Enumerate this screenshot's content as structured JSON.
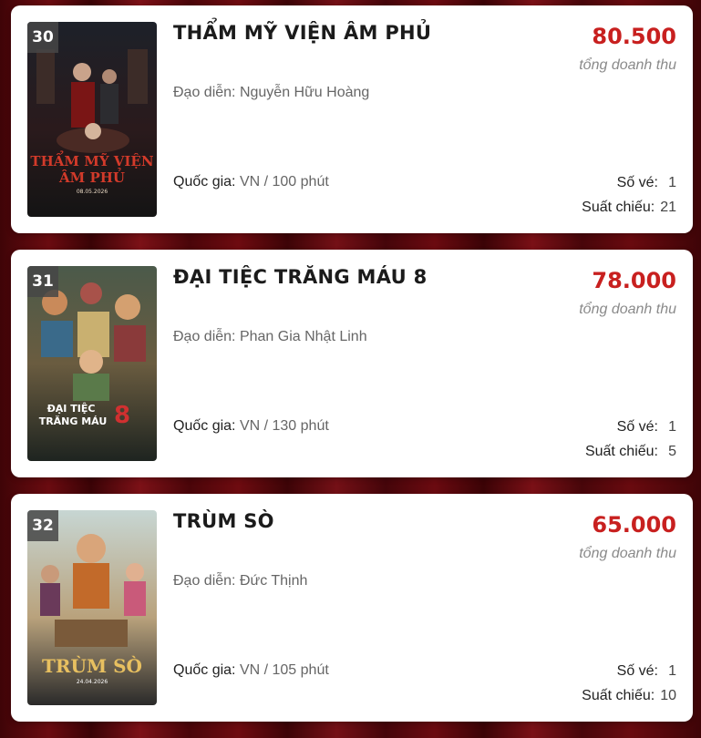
{
  "movies": [
    {
      "rank": "30",
      "title": "THẨM MỸ VIỆN ÂM PHỦ",
      "revenue": "80.500",
      "revenue_label": "tổng doanh thu",
      "director_label": "Đạo diễn: ",
      "director": "Nguyễn Hữu Hoàng",
      "country_label": "Quốc gia: ",
      "country_value": "VN / 100 phút",
      "tickets_label": "Số vé:",
      "tickets": "1",
      "shows_label": "Suất chiếu:",
      "shows": "21",
      "poster_colors": [
        "#1a1e24",
        "#2c1b1d",
        "#5a1416"
      ]
    },
    {
      "rank": "31",
      "title": "ĐẠI TIỆC TRĂNG MÁU 8",
      "revenue": "78.000",
      "revenue_label": "tổng doanh thu",
      "director_label": "Đạo diễn: ",
      "director": "Phan Gia Nhật Linh",
      "country_label": "Quốc gia: ",
      "country_value": "VN / 130 phút",
      "tickets_label": "Số vé:",
      "tickets": "1",
      "shows_label": "Suất chiếu:",
      "shows": "5",
      "poster_colors": [
        "#3d4a3a",
        "#6b5a3a",
        "#1e2420"
      ]
    },
    {
      "rank": "32",
      "title": "TRÙM SÒ",
      "revenue": "65.000",
      "revenue_label": "tổng doanh thu",
      "director_label": "Đạo diễn: ",
      "director": "Đức Thịnh",
      "country_label": "Quốc gia: ",
      "country_value": "VN / 105 phút",
      "tickets_label": "Số vé:",
      "tickets": "1",
      "shows_label": "Suất chiếu:",
      "shows": "10",
      "poster_colors": [
        "#b9c9c7",
        "#c9823a",
        "#2b2b2b"
      ]
    }
  ],
  "colors": {
    "revenue": "#c8201f",
    "background": "#5a0a0d"
  }
}
